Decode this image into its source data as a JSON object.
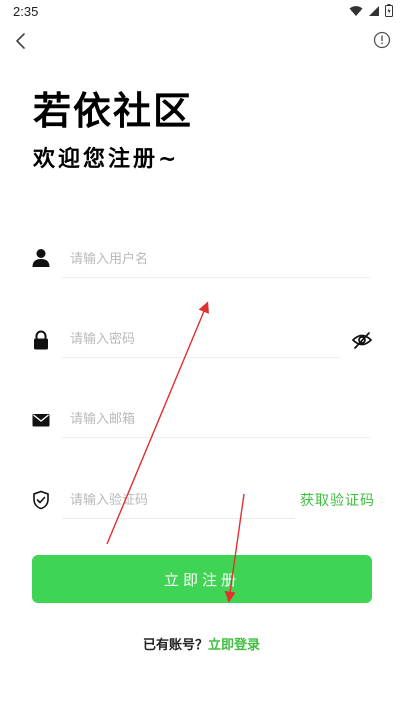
{
  "status_bar": {
    "time": "2:35",
    "icons": [
      "wifi-icon",
      "signal-icon",
      "battery-icon"
    ]
  },
  "header": {
    "back_icon": "chevron-left-icon",
    "info_icon": "info-circle-icon"
  },
  "title": "若依社区",
  "subtitle": "欢迎您注册~",
  "form": {
    "username": {
      "icon": "user-icon",
      "placeholder": "请输入用户名",
      "value": ""
    },
    "password": {
      "icon": "lock-icon",
      "placeholder": "请输入密码",
      "value": "",
      "toggle_icon": "eye-slash-icon"
    },
    "email": {
      "icon": "mail-icon",
      "placeholder": "请输入邮箱",
      "value": ""
    },
    "code": {
      "icon": "shield-check-icon",
      "placeholder": "请输入验证码",
      "value": "",
      "get_code_label": "获取验证码"
    }
  },
  "register_label": "立即注册",
  "login_prompt": "已有账号？",
  "login_link": "立即登录",
  "colors": {
    "accent": "#3fd454",
    "link": "#3fbf3f",
    "annotation": "#e03030"
  }
}
